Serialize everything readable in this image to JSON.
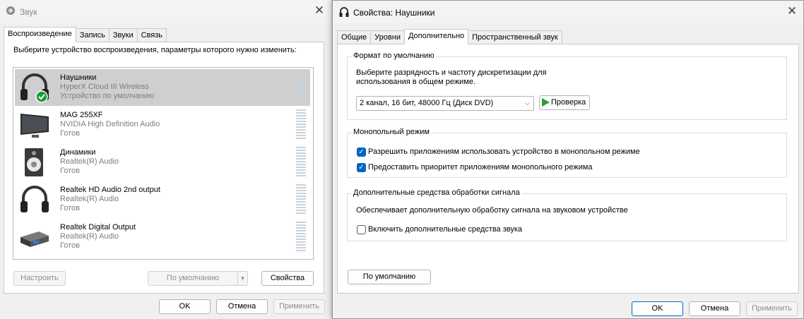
{
  "sound_window": {
    "title": "Звук",
    "tabs": [
      "Воспроизведение",
      "Запись",
      "Звуки",
      "Связь"
    ],
    "description": "Выберите устройство воспроизведения, параметры которого нужно изменить:",
    "devices": [
      {
        "name": "Наушники",
        "sub1": "HyperX Cloud III Wireless",
        "sub2": "Устройство по умолчанию",
        "icon": "headphones-icon"
      },
      {
        "name": "MAG 255XF",
        "sub1": "NVIDIA High Definition Audio",
        "sub2": "Готов",
        "icon": "monitor-icon"
      },
      {
        "name": "Динамики",
        "sub1": "Realtek(R) Audio",
        "sub2": "Готов",
        "icon": "speaker-icon"
      },
      {
        "name": "Realtek HD Audio 2nd output",
        "sub1": "Realtek(R) Audio",
        "sub2": "Готов",
        "icon": "headphones-icon"
      },
      {
        "name": "Realtek Digital Output",
        "sub1": "Realtek(R) Audio",
        "sub2": "Готов",
        "icon": "digital-output-icon"
      }
    ],
    "configure_label": "Настроить",
    "default_label": "По умолчанию",
    "properties_label": "Свойства",
    "ok_label": "OK",
    "cancel_label": "Отмена",
    "apply_label": "Применить"
  },
  "props_window": {
    "title": "Свойства: Наушники",
    "tabs": [
      "Общие",
      "Уровни",
      "Дополнительно",
      "Пространственный звук"
    ],
    "format_group": {
      "title": "Формат по умолчанию",
      "description_line1": "Выберите разрядность и частоту дискретизации для",
      "description_line2": "использования в общем режиме.",
      "selected_format": "2 канал, 16 бит, 48000 Гц (Диск DVD)",
      "test_label": "Проверка"
    },
    "exclusive_group": {
      "title": "Монопольный режим",
      "option1": "Разрешить приложениям использовать устройство в монопольном режиме",
      "option2": "Предоставить приоритет приложениям монопольного режима"
    },
    "enhancements_group": {
      "title": "Дополнительные средства обработки сигнала",
      "description": "Обеспечивает дополнительную обработку сигнала на звуковом устройстве",
      "option": "Включить дополнительные средства звука"
    },
    "restore_default_label": "По умолчанию",
    "ok_label": "OK",
    "cancel_label": "Отмена",
    "apply_label": "Применить"
  }
}
